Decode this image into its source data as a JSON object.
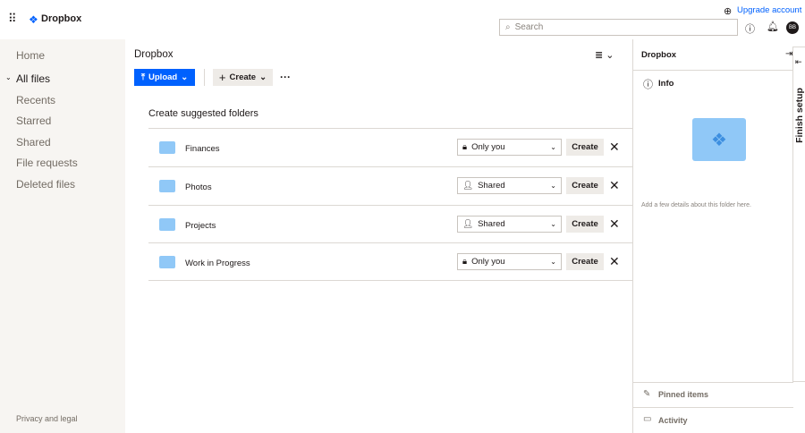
{
  "header": {
    "brand": "Dropbox",
    "upgrade": "Upgrade account",
    "search_placeholder": "Search",
    "avatar": "BB"
  },
  "sidebar": {
    "items": [
      "Home",
      "All files",
      "Recents",
      "Starred",
      "Shared",
      "File requests",
      "Deleted files"
    ],
    "footer": "Privacy and legal"
  },
  "main": {
    "title": "Dropbox",
    "upload": "Upload",
    "create": "Create",
    "section_title": "Create suggested folders",
    "rows": [
      {
        "name": "Finances",
        "access": "Only you",
        "action": "Create"
      },
      {
        "name": "Photos",
        "access": "Shared",
        "action": "Create"
      },
      {
        "name": "Projects",
        "access": "Shared",
        "action": "Create"
      },
      {
        "name": "Work in Progress",
        "access": "Only you",
        "action": "Create"
      }
    ]
  },
  "panel": {
    "title": "Dropbox",
    "info": "Info",
    "details": "Add a few details about this folder here.",
    "pinned": "Pinned items",
    "activity": "Activity",
    "finish": "Finish setup"
  },
  "colors": {
    "accent": "#0061fe",
    "folder": "#90c8f7",
    "sidebar": "#f7f5f2"
  }
}
